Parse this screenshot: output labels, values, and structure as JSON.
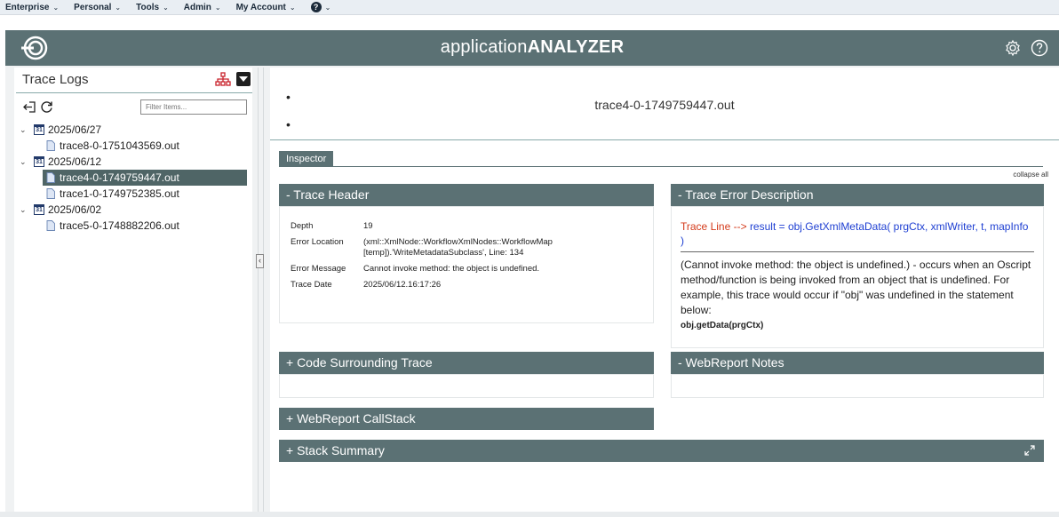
{
  "topnav": {
    "menus": [
      "Enterprise",
      "Personal",
      "Tools",
      "Admin",
      "My Account"
    ],
    "help_label": "?"
  },
  "app": {
    "title_light": "application",
    "title_bold": "ANALYZER"
  },
  "trace_logs": {
    "title": "Trace Logs",
    "filter_placeholder": "Filter Items...",
    "groups": [
      {
        "date": "2025/06/27",
        "files": [
          "trace8-0-1751043569.out"
        ]
      },
      {
        "date": "2025/06/12",
        "files": [
          "trace4-0-1749759447.out",
          "trace1-0-1749752385.out"
        ]
      },
      {
        "date": "2025/06/02",
        "files": [
          "trace5-0-1748882206.out"
        ]
      }
    ],
    "selected_file": "trace4-0-1749759447.out"
  },
  "main": {
    "bullets": [
      "",
      ""
    ],
    "filename": "trace4-0-1749759447.out",
    "inspector_tab": "Inspector",
    "collapse_all": "collapse all"
  },
  "trace_header": {
    "title": "- Trace Header",
    "rows": [
      {
        "key": "Depth",
        "value": "19"
      },
      {
        "key": "Error Location",
        "value": "(xml::XmlNode::WorkflowXmlNodes::WorkflowMap [temp]).'WriteMetadataSubclass', Line: 134"
      },
      {
        "key": "Error Message",
        "value": "Cannot invoke method: the object is undefined."
      },
      {
        "key": "Trace Date",
        "value": "2025/06/12.16:17:26"
      }
    ]
  },
  "trace_error": {
    "title": "- Trace Error Description",
    "label": "Trace Line -->",
    "code": "result = obj.GetXmlMetaData( prgCtx, xmlWriter, t, mapInfo )",
    "description": "(Cannot invoke method: the object is undefined.) - occurs when an Oscript method/function is being invoked from an object that is undefined. For example, this trace would occur if \"obj\" was undefined in the statement below:",
    "example": "obj.getData(prgCtx)"
  },
  "panels": {
    "code_surrounding": "+ Code Surrounding Trace",
    "webreport_notes": "- WebReport Notes",
    "webreport_callstack": "+ WebReport CallStack",
    "stack_summary": "+ Stack Summary"
  },
  "collapse_handle": "‹",
  "colors": {
    "header_bg": "#5b7174",
    "selected_bg": "#4f6566",
    "error_label": "#d43a1a",
    "error_code": "#1e3fd2"
  }
}
